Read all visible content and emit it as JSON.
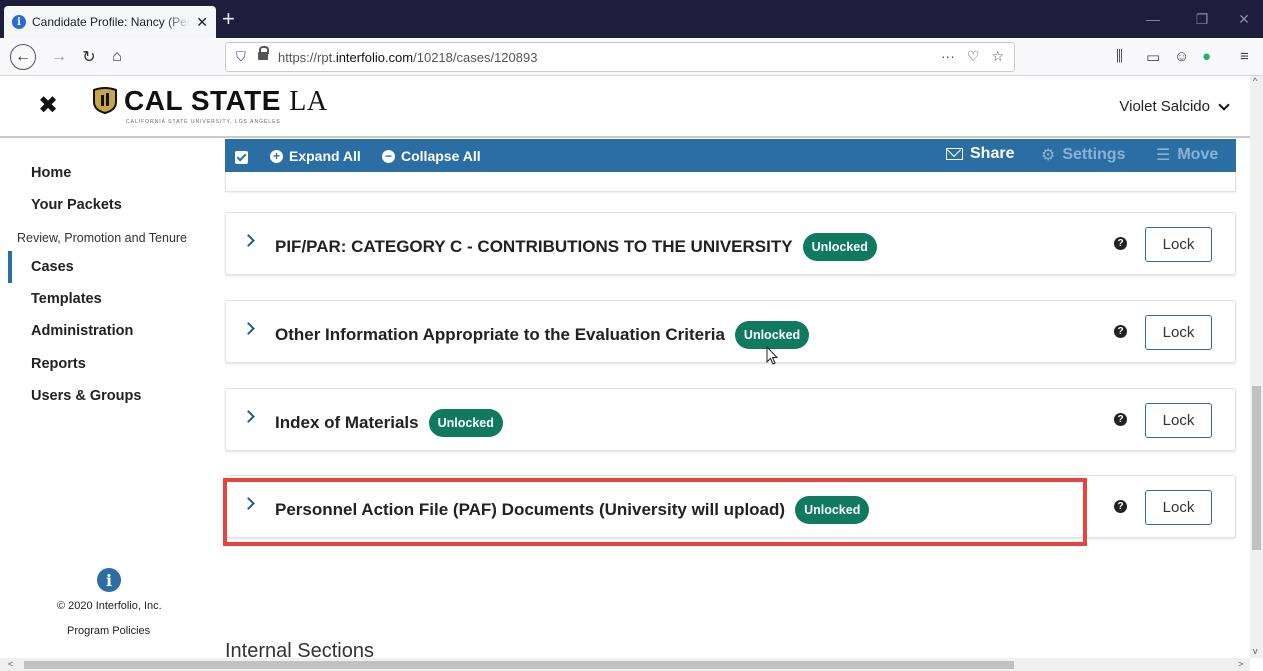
{
  "browser": {
    "tab_title": "Candidate Profile: Nancy (Perf",
    "url_prefix": "https://rpt.",
    "url_domain": "interfolio.com",
    "url_path": "/10218/cases/120893"
  },
  "header": {
    "brand_main": "CAL STATE",
    "brand_suffix": "LA",
    "brand_sub": "CALIFORNIA STATE UNIVERSITY, LOS ANGELES",
    "user_name": "Violet Salcido"
  },
  "sidebar": {
    "items": [
      {
        "label": "Home"
      },
      {
        "label": "Your Packets"
      },
      {
        "label": "Review, Promotion and Tenure"
      },
      {
        "label": "Cases"
      },
      {
        "label": "Templates"
      },
      {
        "label": "Administration"
      },
      {
        "label": "Reports"
      },
      {
        "label": "Users & Groups"
      }
    ],
    "copyright": "© 2020 Interfolio, Inc.",
    "policies": "Program Policies"
  },
  "toolbar": {
    "expand_all": "Expand All",
    "collapse_all": "Collapse All",
    "share": "Share",
    "settings": "Settings",
    "move": "Move"
  },
  "sections": [
    {
      "title": "PIF/PAR: CATEGORY C - CONTRIBUTIONS TO THE UNIVERSITY",
      "status": "Unlocked",
      "action": "Lock"
    },
    {
      "title": "Other Information Appropriate to the Evaluation Criteria",
      "status": "Unlocked",
      "action": "Lock"
    },
    {
      "title": "Index of Materials",
      "status": "Unlocked",
      "action": "Lock"
    },
    {
      "title": "Personnel Action File (PAF) Documents (University will upload)",
      "status": "Unlocked",
      "action": "Lock"
    }
  ],
  "internal_sections_heading": "Internal Sections",
  "colors": {
    "primary": "#2a6ea3",
    "badge": "#0f7a5e",
    "highlight": "#e8433f"
  }
}
